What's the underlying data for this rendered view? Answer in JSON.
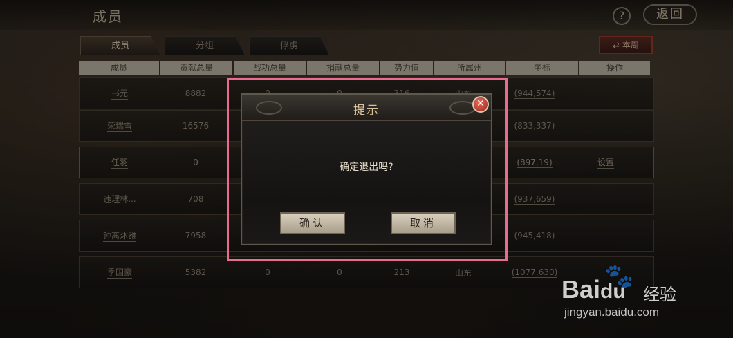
{
  "header": {
    "title": "成员",
    "help_label": "?",
    "back_label": "返回"
  },
  "tabs": [
    {
      "label": "成员",
      "active": true
    },
    {
      "label": "分组",
      "active": false
    },
    {
      "label": "俘虏",
      "active": false
    }
  ],
  "week_button": {
    "label": "本周"
  },
  "table": {
    "columns": [
      "成员",
      "贡献总量",
      "战功总量",
      "捐献总量",
      "势力值",
      "所属州",
      "坐标",
      "操作"
    ],
    "rows": [
      {
        "name": "书元",
        "contribution": "8882",
        "merit": "0",
        "donation": "0",
        "power": "316",
        "province": "山东",
        "coord": "(944,574)",
        "op": ""
      },
      {
        "name": "荣瑞雪",
        "contribution": "16576",
        "merit": "",
        "donation": "",
        "power": "",
        "province": "",
        "coord": "(833,337)",
        "op": ""
      },
      {
        "name": "任羽",
        "contribution": "0",
        "merit": "",
        "donation": "",
        "power": "",
        "province": "",
        "coord": "(897,19)",
        "op": "设置"
      },
      {
        "name": "违理林...",
        "contribution": "708",
        "merit": "",
        "donation": "",
        "power": "",
        "province": "",
        "coord": "(937,659)",
        "op": ""
      },
      {
        "name": "钟离沐雅",
        "contribution": "7958",
        "merit": "",
        "donation": "",
        "power": "",
        "province": "",
        "coord": "(945,418)",
        "op": ""
      },
      {
        "name": "季国豪",
        "contribution": "5382",
        "merit": "0",
        "donation": "0",
        "power": "213",
        "province": "山东",
        "coord": "(1077,630)",
        "op": ""
      }
    ]
  },
  "dialog": {
    "title": "提示",
    "message": "确定退出吗?",
    "confirm_label": "确认",
    "cancel_label": "取消",
    "close_label": "✕"
  },
  "watermark": {
    "brand": "Bai",
    "brand_cn": "经验",
    "url": "jingyan.baidu.com"
  },
  "colors": {
    "highlight": "#ec6a90",
    "dialog_title": "#d8c39a",
    "close_red": "#a0261c"
  }
}
